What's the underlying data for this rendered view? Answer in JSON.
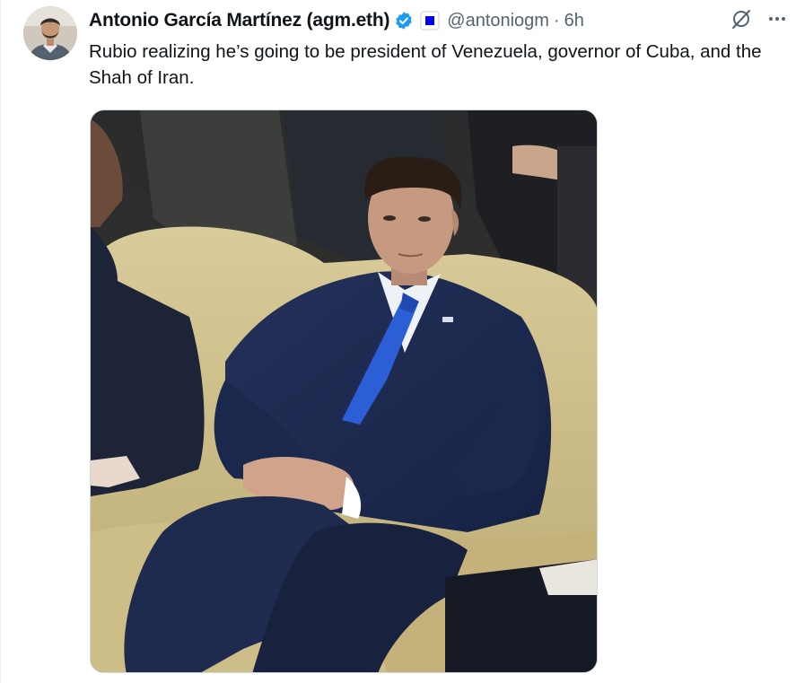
{
  "tweet": {
    "author": {
      "display_name": "Antonio García Martínez (agm.eth)",
      "handle": "@antoniogm",
      "avatar_icon": "profile-photo",
      "verified_icon": "blue-check-badge",
      "affiliation_icon": "blue-square-badge"
    },
    "separator": "·",
    "timestamp": "6h",
    "text": "Rubio realizing he’s going to be president of Venezuela, governor of Cuba, and the Shah of Iran.",
    "media": {
      "kind": "photo"
    },
    "actions": {
      "grok_icon": "grok-icon",
      "more_icon": "more-dots-icon"
    }
  },
  "colors": {
    "text_primary": "#0f1419",
    "text_secondary": "#536471",
    "verified_blue": "#1d9bf0",
    "media_border": "#cfd9de"
  }
}
